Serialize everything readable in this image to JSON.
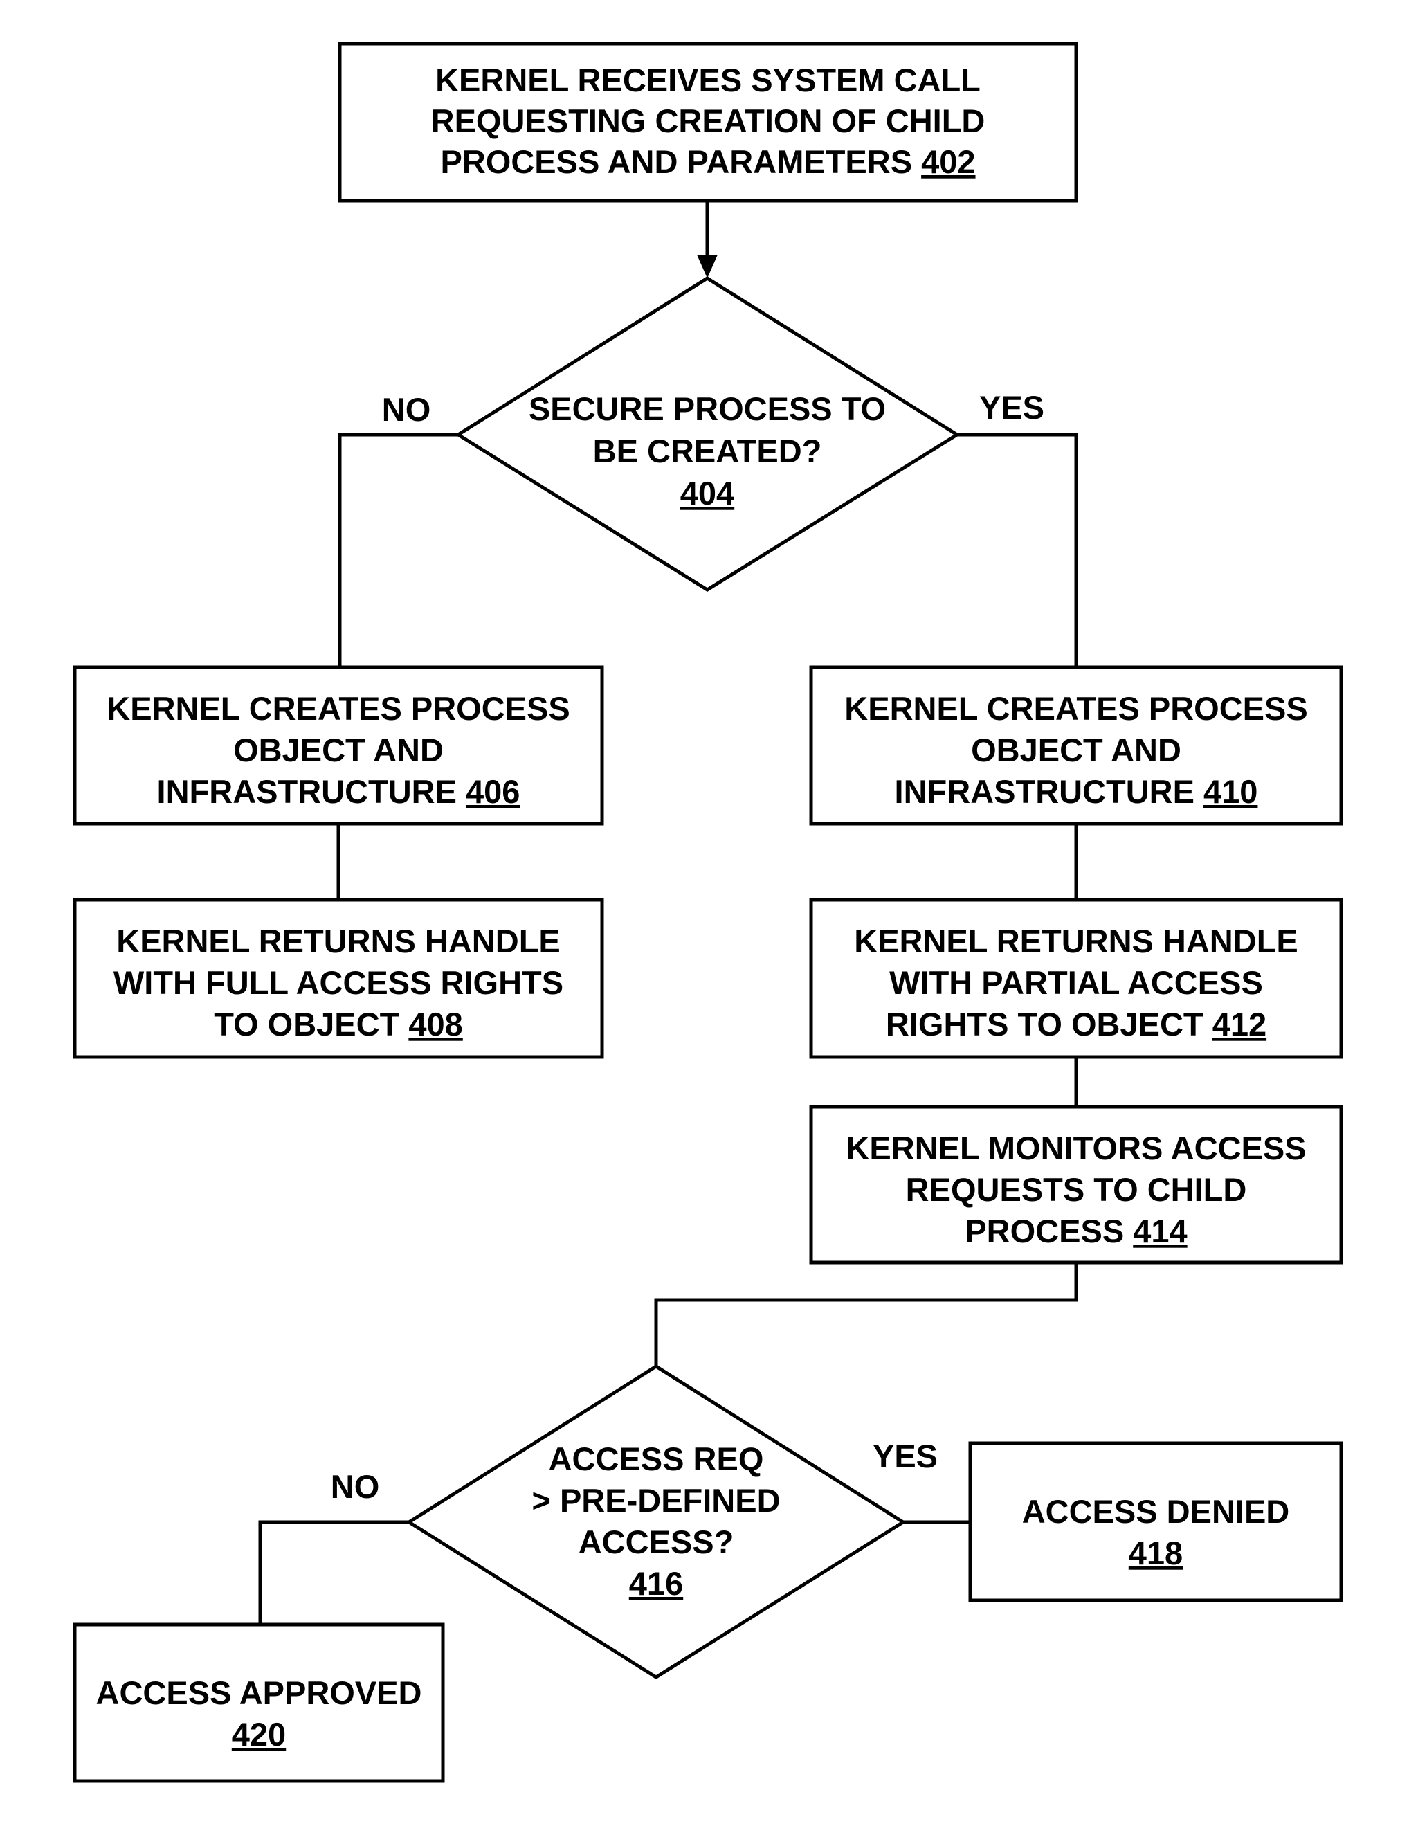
{
  "figure": {
    "nodes": [
      {
        "id": "402",
        "type": "process",
        "lines": [
          "KERNEL RECEIVES SYSTEM CALL",
          "REQUESTING CREATION OF CHILD",
          "PROCESS AND PARAMETERS"
        ],
        "ref": "402"
      },
      {
        "id": "404",
        "type": "decision",
        "lines": [
          "SECURE PROCESS TO",
          "BE CREATED?"
        ],
        "ref": "404"
      },
      {
        "id": "406",
        "type": "process",
        "lines": [
          "KERNEL CREATES PROCESS",
          "OBJECT AND",
          "INFRASTRUCTURE "
        ],
        "ref": "406"
      },
      {
        "id": "408",
        "type": "process",
        "lines": [
          "KERNEL RETURNS HANDLE",
          "WITH FULL ACCESS RIGHTS",
          "TO OBJECT"
        ],
        "ref": "408"
      },
      {
        "id": "410",
        "type": "process",
        "lines": [
          "KERNEL CREATES PROCESS",
          "OBJECT AND",
          "INFRASTRUCTURE "
        ],
        "ref": "410"
      },
      {
        "id": "412",
        "type": "process",
        "lines": [
          "KERNEL RETURNS HANDLE",
          "WITH PARTIAL ACCESS",
          "RIGHTS TO OBJECT"
        ],
        "ref": "412"
      },
      {
        "id": "414",
        "type": "process",
        "lines": [
          "KERNEL MONITORS ACCESS",
          "REQUESTS TO CHILD",
          "PROCESS "
        ],
        "ref": "414"
      },
      {
        "id": "416",
        "type": "decision",
        "lines": [
          "ACCESS REQ",
          "> PRE-DEFINED",
          "ACCESS?"
        ],
        "ref": "416"
      },
      {
        "id": "418",
        "type": "terminal",
        "lines": [
          "ACCESS DENIED"
        ],
        "ref": "418"
      },
      {
        "id": "420",
        "type": "terminal",
        "lines": [
          "ACCESS APPROVED"
        ],
        "ref": "420"
      }
    ],
    "edges": [
      {
        "from": "402",
        "to": "404",
        "label": "",
        "arrow": true
      },
      {
        "from": "404",
        "to": "406",
        "label": "NO"
      },
      {
        "from": "404",
        "to": "410",
        "label": "YES"
      },
      {
        "from": "406",
        "to": "408",
        "label": ""
      },
      {
        "from": "410",
        "to": "412",
        "label": ""
      },
      {
        "from": "412",
        "to": "414",
        "label": ""
      },
      {
        "from": "414",
        "to": "416",
        "label": ""
      },
      {
        "from": "416",
        "to": "418",
        "label": "YES"
      },
      {
        "from": "416",
        "to": "420",
        "label": "NO"
      }
    ],
    "branch_labels": {
      "no_404": "NO",
      "yes_404": "YES",
      "no_416": "NO",
      "yes_416": "YES"
    }
  }
}
